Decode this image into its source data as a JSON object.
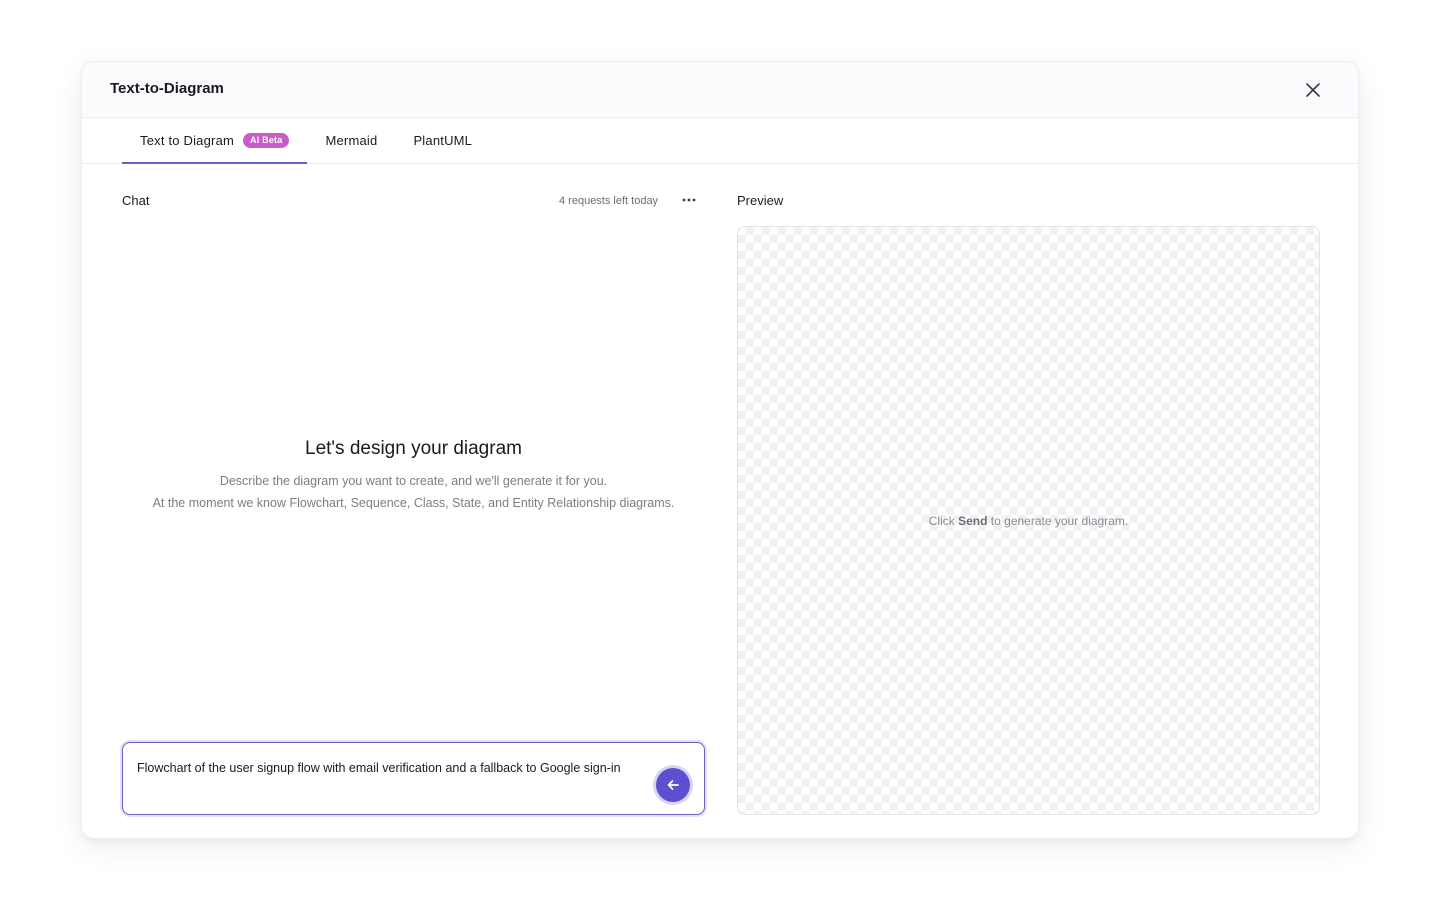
{
  "modal": {
    "title": "Text-to-Diagram"
  },
  "tabs": [
    {
      "label": "Text to Diagram",
      "badge": "AI Beta",
      "active": true
    },
    {
      "label": "Mermaid",
      "active": false
    },
    {
      "label": "PlantUML",
      "active": false
    }
  ],
  "chat": {
    "label": "Chat",
    "requests_left": "4 requests left today",
    "empty_title": "Let's design your diagram",
    "empty_desc_line1": "Describe the diagram you want to create, and we'll generate it for you.",
    "empty_desc_line2": "At the moment we know Flowchart, Sequence, Class, State, and Entity Relationship diagrams.",
    "input_value": "Flowchart of the user signup flow with email verification and a fallback to Google sign-in"
  },
  "preview": {
    "label": "Preview",
    "hint_prefix": "Click",
    "hint_bold": "Send",
    "hint_suffix": "to generate your diagram."
  },
  "icons": {
    "close": "close-icon",
    "more": "more-horizontal-icon",
    "send": "arrow-left-icon"
  },
  "colors": {
    "accent": "#5b50d0",
    "tab_underline": "#6a5fc1",
    "badge": "#c95cc8"
  }
}
